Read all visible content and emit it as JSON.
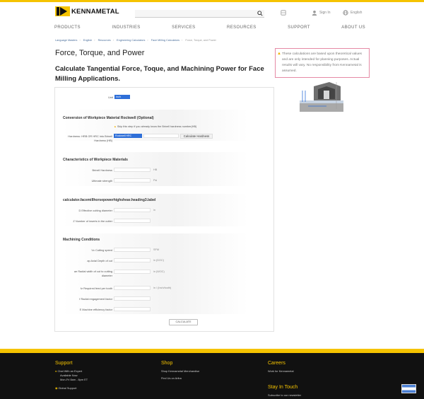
{
  "header": {
    "logo_text": "KENNAMETAL",
    "search_placeholder": "",
    "globe_label": "",
    "signin_label": "Sign In",
    "language_label": "English"
  },
  "nav": {
    "items": [
      "PRODUCTS",
      "INDUSTRIES",
      "SERVICES",
      "RESOURCES",
      "SUPPORT",
      "ABOUT US"
    ]
  },
  "breadcrumb": {
    "items": [
      "Language Masters",
      "English",
      "Resources",
      "Engineering Calculators",
      "Face Milling Calculators"
    ],
    "current": "Force, Torque, and Power"
  },
  "page": {
    "title": "Force, Torque, and Power",
    "subtitle": "Calculate Tangential Force, Toque, and Machining Power for Face Milling Applications."
  },
  "notice": {
    "text": "These calculations are based upon theoretical values and are only intended for planning purposes. Actual results will vary. No responsibility from Kennametal is assumed."
  },
  "form": {
    "unit_label": "Unit",
    "unit_value": "inch",
    "conversion": {
      "title": "Conversion of Workpiece Material Rockwell (Optional)",
      "hint": "Skip this step if you already know the Brinell hardness number(HB)",
      "hardness_label": "Hardness: HRB OR HRC into Brinell Hardness (HB)",
      "hardness_select": "Rockwell HRC",
      "calc_button": "Calculate Hardness"
    },
    "characteristics": {
      "title": "Characteristics of Workpiece Materials",
      "brinell_label": "Brinell Hardness",
      "brinell_unit": "HB",
      "uts_label": "Ultimate strength",
      "uts_unit": "Psi"
    },
    "heading3": {
      "title": "calculator.facemillhorsepowerhighshear.heading3.label",
      "diameter_label": "D Effective cutting diameter",
      "diameter_unit": "in",
      "inserts_label": "Z Number of inserts in the cutter"
    },
    "machining": {
      "title": "Machining Conditions",
      "speed_label": "Vc Cutting speed",
      "speed_unit": "SFM",
      "depth_label": "ap Axial Depth of cut",
      "depth_unit": "in (DOC)",
      "width_label": "ae Radial width of cut to cutting diameter",
      "width_unit": "in (WOC)",
      "feed_label": "fz Required feed per tooth",
      "feed_unit": "in / (Inch/tooth)",
      "engagement_label": "f Radial engagement factor",
      "efficiency_label": "E Machine efficiency factor"
    },
    "calculate_button": "CALCULATE"
  },
  "footer": {
    "support": {
      "title": "Support",
      "chat": "Chat With an Expert",
      "available": "Available Now",
      "hours": "Mon-Fri 8am - 8pm ET",
      "global": "Global Support"
    },
    "shop": {
      "title": "Shop",
      "merch": "Shop Kennametal Merchandise",
      "ariba": "Find Us on Ariba"
    },
    "careers": {
      "title": "Careers",
      "work": "Work for Kennametal"
    },
    "stay": {
      "title": "Stay In Touch",
      "subscribe": "Subscribe to our newsletter"
    }
  },
  "colors": {
    "brand_yellow": "#f5c300",
    "link_blue": "#4a6e9b",
    "select_blue": "#2f6fd8",
    "notice_border": "#e58aa5"
  }
}
